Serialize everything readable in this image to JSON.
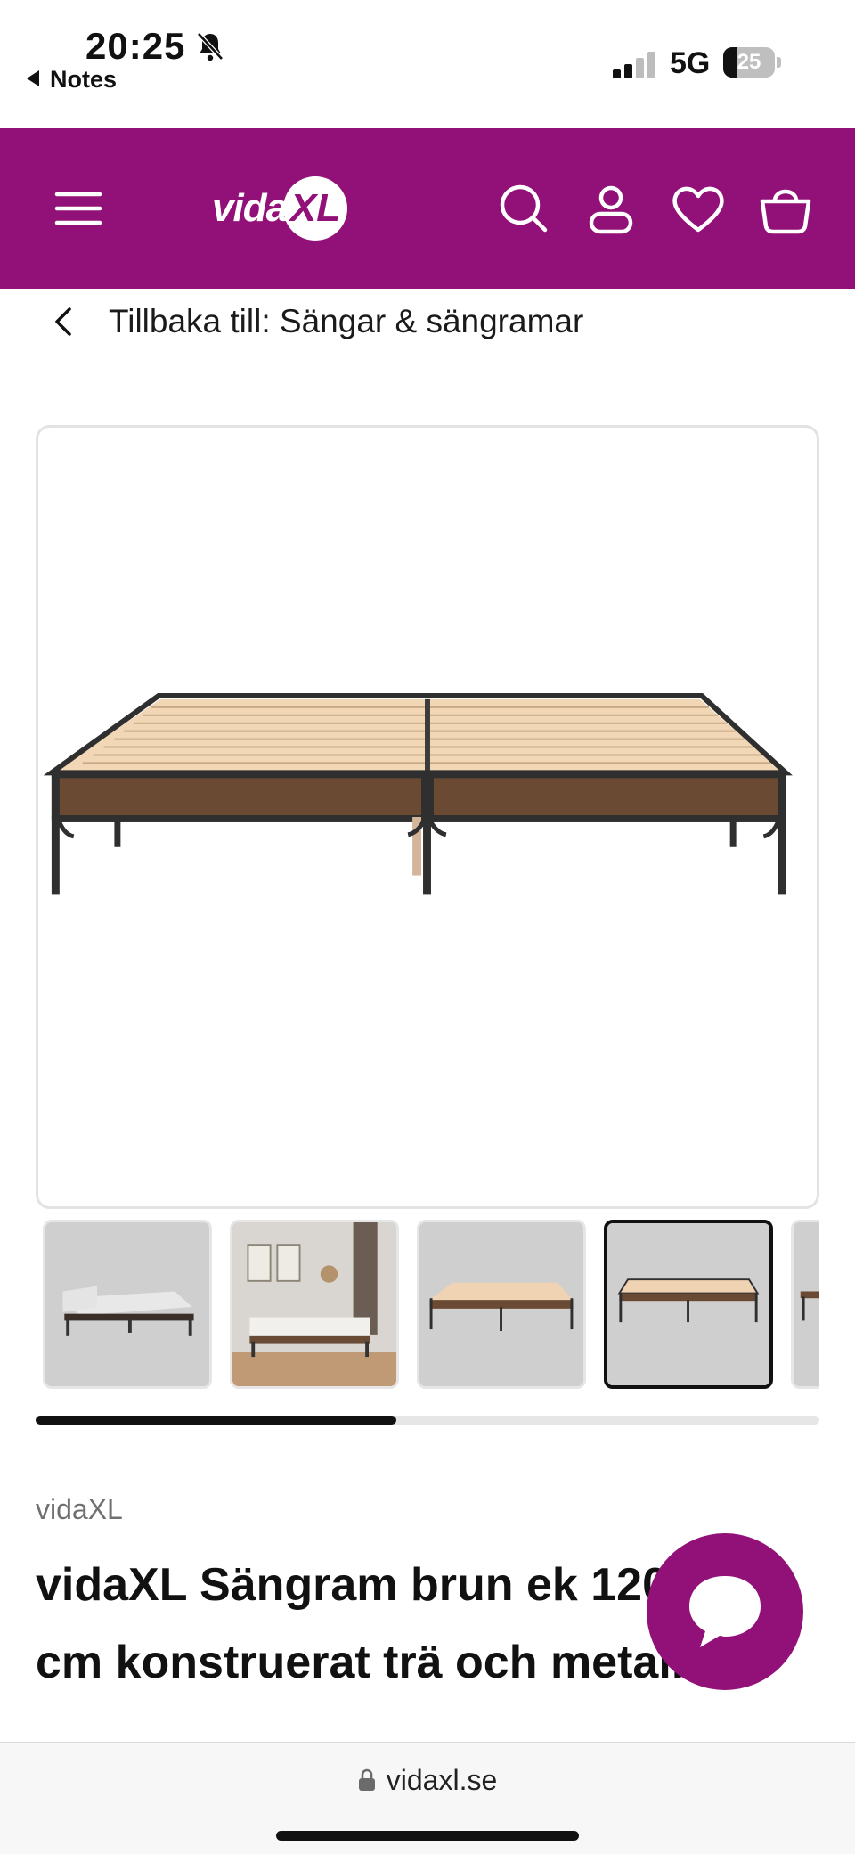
{
  "status_bar": {
    "time": "20:25",
    "back_label": "Notes",
    "network": "5G",
    "battery_level": "25",
    "battery_fraction": 0.25,
    "signal_bars_active": 2,
    "icons": [
      "bell-slash-icon",
      "signal-icon",
      "battery-icon"
    ]
  },
  "header": {
    "background_color": "#921178",
    "logo_text": "vida",
    "logo_mark": "XL",
    "icons": [
      "menu-icon",
      "search-icon",
      "account-icon",
      "wishlist-heart-icon",
      "cart-basket-icon"
    ]
  },
  "breadcrumb": {
    "label": "Tillbaka till: Sängar & sängramar"
  },
  "gallery": {
    "main_image_alt": "bed-frame-image",
    "thumbnails": [
      {
        "name": "thumbnail-1",
        "active": false
      },
      {
        "name": "thumbnail-2",
        "active": false
      },
      {
        "name": "thumbnail-3",
        "active": false
      },
      {
        "name": "thumbnail-4",
        "active": true
      },
      {
        "name": "thumbnail-5",
        "active": false
      }
    ],
    "scroll_progress": 0.46
  },
  "product": {
    "brand": "vidaXL",
    "title": "vidaXL Sängram brun ek 120x200 cm konstruerat trä och metall"
  },
  "browser": {
    "url": "vidaxl.se"
  },
  "colors": {
    "brand_purple": "#921178",
    "text": "#111111",
    "muted": "#707070"
  }
}
